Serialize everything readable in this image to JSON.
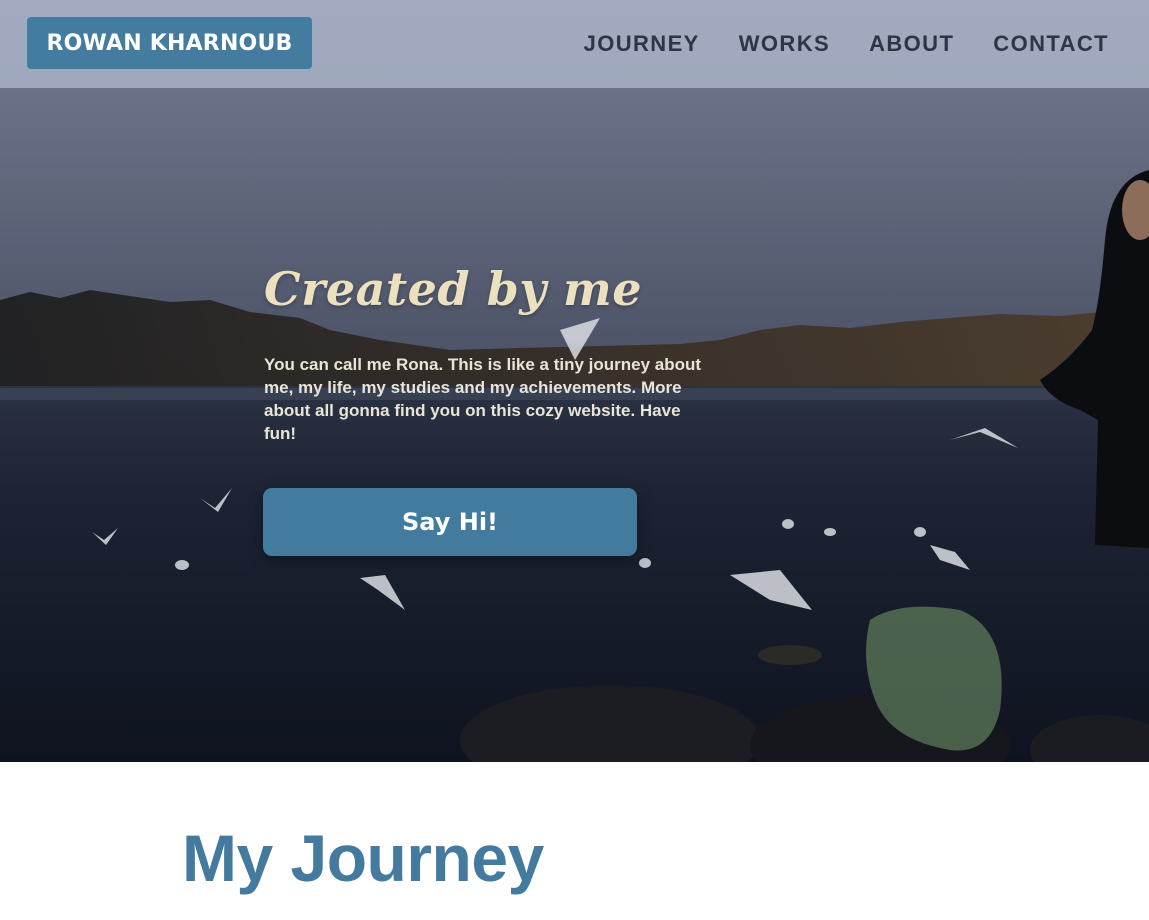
{
  "navbar": {
    "brand_label": "ROWAN KHARNOUB",
    "links": [
      {
        "label": "JOURNEY"
      },
      {
        "label": "WORKS"
      },
      {
        "label": "ABOUT"
      },
      {
        "label": "CONTACT"
      }
    ]
  },
  "hero": {
    "title": "Created by me",
    "text": "You can call me Rona. This is like a tiny journey about me, my life, my studies and my achievements. More about all gonna find you on this cozy website. Have fun!",
    "cta_label": "Say Hi!",
    "background_image": "lake-at-dusk-with-seagulls"
  },
  "journey": {
    "heading": "My Journey"
  },
  "colors": {
    "accent": "#437c9f",
    "nav_bg": "#acb6c9",
    "nav_text": "#2f3446",
    "hero_title": "#ece1bf",
    "heading_blue": "#437a9e"
  }
}
